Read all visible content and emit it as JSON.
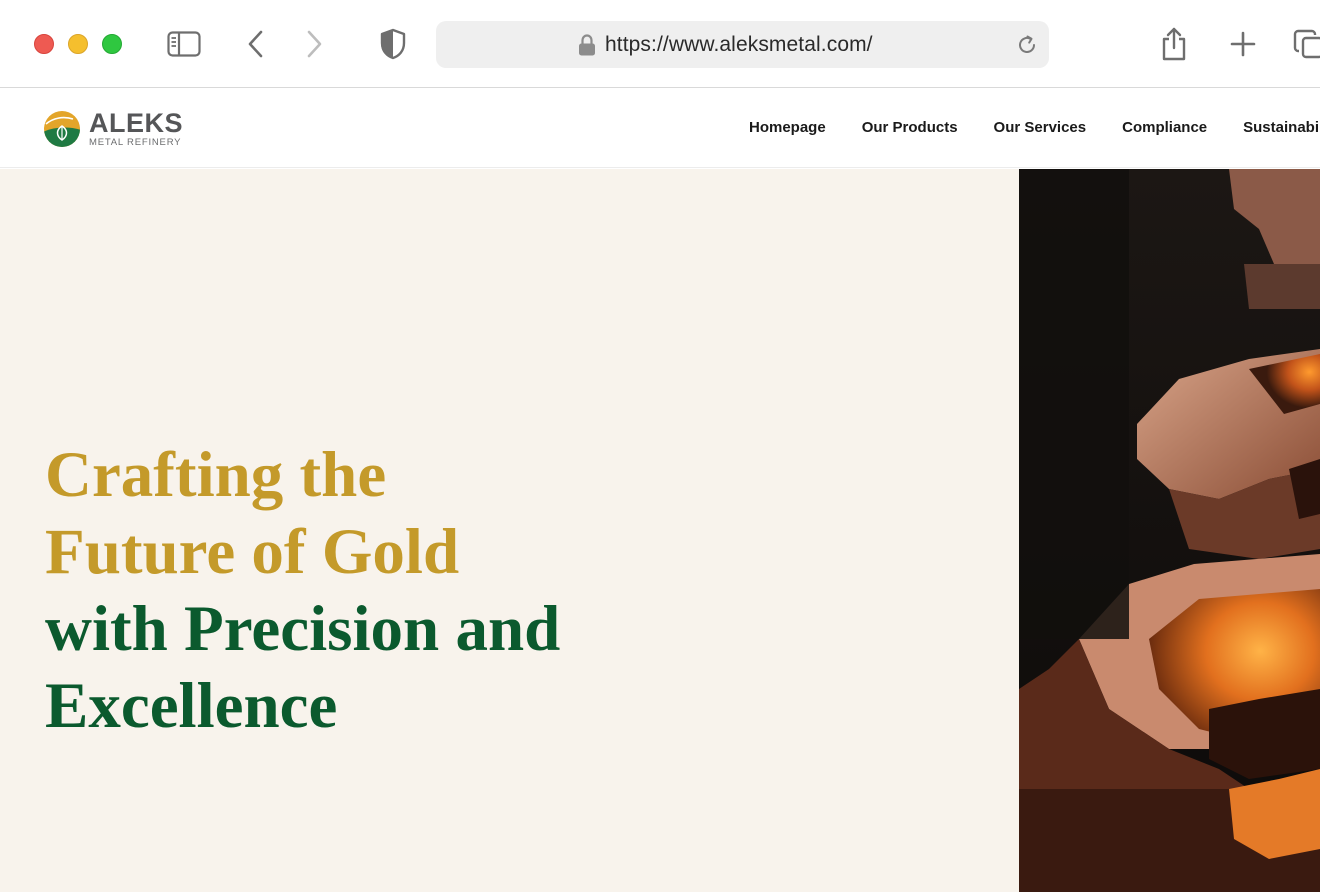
{
  "browser": {
    "url": "https://www.aleksmetal.com/",
    "icons": [
      "sidebar-icon",
      "back-icon",
      "forward-icon",
      "shield-icon",
      "lock-icon",
      "reload-icon",
      "share-icon",
      "new-tab-icon",
      "tabs-overview-icon"
    ]
  },
  "header": {
    "logo": {
      "name": "ALEKS",
      "subtitle": "METAL REFINERY"
    },
    "nav": [
      "Homepage",
      "Our Products",
      "Our Services",
      "Compliance",
      "Sustainability"
    ]
  },
  "hero": {
    "headline_gold": [
      "Crafting the",
      "Future of Gold"
    ],
    "headline_green": [
      "with Precision and",
      "Excellence"
    ],
    "image": "molten-gold-casting-photo"
  },
  "colors": {
    "gold": "#c49a2a",
    "green": "#0b5a2e",
    "hero_bg": "#f8f3ec",
    "traffic_red": "#ee5a52",
    "traffic_yellow": "#f5bf2e",
    "traffic_green": "#2fc740"
  }
}
